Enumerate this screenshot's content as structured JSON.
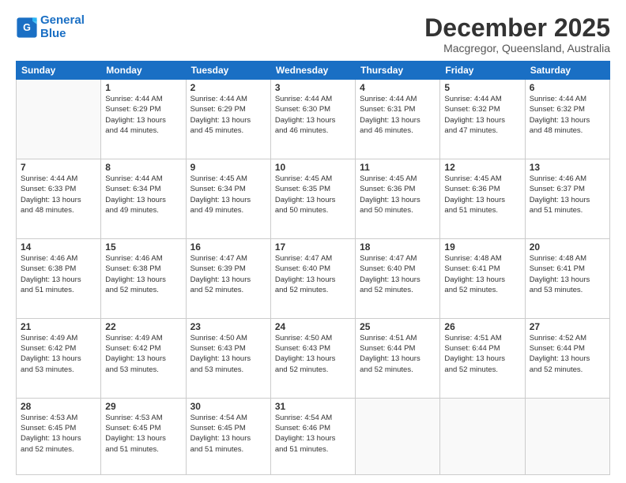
{
  "header": {
    "logo_line1": "General",
    "logo_line2": "Blue",
    "month": "December 2025",
    "location": "Macgregor, Queensland, Australia"
  },
  "weekdays": [
    "Sunday",
    "Monday",
    "Tuesday",
    "Wednesday",
    "Thursday",
    "Friday",
    "Saturday"
  ],
  "weeks": [
    [
      {
        "day": "",
        "info": ""
      },
      {
        "day": "1",
        "info": "Sunrise: 4:44 AM\nSunset: 6:29 PM\nDaylight: 13 hours\nand 44 minutes."
      },
      {
        "day": "2",
        "info": "Sunrise: 4:44 AM\nSunset: 6:29 PM\nDaylight: 13 hours\nand 45 minutes."
      },
      {
        "day": "3",
        "info": "Sunrise: 4:44 AM\nSunset: 6:30 PM\nDaylight: 13 hours\nand 46 minutes."
      },
      {
        "day": "4",
        "info": "Sunrise: 4:44 AM\nSunset: 6:31 PM\nDaylight: 13 hours\nand 46 minutes."
      },
      {
        "day": "5",
        "info": "Sunrise: 4:44 AM\nSunset: 6:32 PM\nDaylight: 13 hours\nand 47 minutes."
      },
      {
        "day": "6",
        "info": "Sunrise: 4:44 AM\nSunset: 6:32 PM\nDaylight: 13 hours\nand 48 minutes."
      }
    ],
    [
      {
        "day": "7",
        "info": "Sunrise: 4:44 AM\nSunset: 6:33 PM\nDaylight: 13 hours\nand 48 minutes."
      },
      {
        "day": "8",
        "info": "Sunrise: 4:44 AM\nSunset: 6:34 PM\nDaylight: 13 hours\nand 49 minutes."
      },
      {
        "day": "9",
        "info": "Sunrise: 4:45 AM\nSunset: 6:34 PM\nDaylight: 13 hours\nand 49 minutes."
      },
      {
        "day": "10",
        "info": "Sunrise: 4:45 AM\nSunset: 6:35 PM\nDaylight: 13 hours\nand 50 minutes."
      },
      {
        "day": "11",
        "info": "Sunrise: 4:45 AM\nSunset: 6:36 PM\nDaylight: 13 hours\nand 50 minutes."
      },
      {
        "day": "12",
        "info": "Sunrise: 4:45 AM\nSunset: 6:36 PM\nDaylight: 13 hours\nand 51 minutes."
      },
      {
        "day": "13",
        "info": "Sunrise: 4:46 AM\nSunset: 6:37 PM\nDaylight: 13 hours\nand 51 minutes."
      }
    ],
    [
      {
        "day": "14",
        "info": "Sunrise: 4:46 AM\nSunset: 6:38 PM\nDaylight: 13 hours\nand 51 minutes."
      },
      {
        "day": "15",
        "info": "Sunrise: 4:46 AM\nSunset: 6:38 PM\nDaylight: 13 hours\nand 52 minutes."
      },
      {
        "day": "16",
        "info": "Sunrise: 4:47 AM\nSunset: 6:39 PM\nDaylight: 13 hours\nand 52 minutes."
      },
      {
        "day": "17",
        "info": "Sunrise: 4:47 AM\nSunset: 6:40 PM\nDaylight: 13 hours\nand 52 minutes."
      },
      {
        "day": "18",
        "info": "Sunrise: 4:47 AM\nSunset: 6:40 PM\nDaylight: 13 hours\nand 52 minutes."
      },
      {
        "day": "19",
        "info": "Sunrise: 4:48 AM\nSunset: 6:41 PM\nDaylight: 13 hours\nand 52 minutes."
      },
      {
        "day": "20",
        "info": "Sunrise: 4:48 AM\nSunset: 6:41 PM\nDaylight: 13 hours\nand 53 minutes."
      }
    ],
    [
      {
        "day": "21",
        "info": "Sunrise: 4:49 AM\nSunset: 6:42 PM\nDaylight: 13 hours\nand 53 minutes."
      },
      {
        "day": "22",
        "info": "Sunrise: 4:49 AM\nSunset: 6:42 PM\nDaylight: 13 hours\nand 53 minutes."
      },
      {
        "day": "23",
        "info": "Sunrise: 4:50 AM\nSunset: 6:43 PM\nDaylight: 13 hours\nand 53 minutes."
      },
      {
        "day": "24",
        "info": "Sunrise: 4:50 AM\nSunset: 6:43 PM\nDaylight: 13 hours\nand 52 minutes."
      },
      {
        "day": "25",
        "info": "Sunrise: 4:51 AM\nSunset: 6:44 PM\nDaylight: 13 hours\nand 52 minutes."
      },
      {
        "day": "26",
        "info": "Sunrise: 4:51 AM\nSunset: 6:44 PM\nDaylight: 13 hours\nand 52 minutes."
      },
      {
        "day": "27",
        "info": "Sunrise: 4:52 AM\nSunset: 6:44 PM\nDaylight: 13 hours\nand 52 minutes."
      }
    ],
    [
      {
        "day": "28",
        "info": "Sunrise: 4:53 AM\nSunset: 6:45 PM\nDaylight: 13 hours\nand 52 minutes."
      },
      {
        "day": "29",
        "info": "Sunrise: 4:53 AM\nSunset: 6:45 PM\nDaylight: 13 hours\nand 51 minutes."
      },
      {
        "day": "30",
        "info": "Sunrise: 4:54 AM\nSunset: 6:45 PM\nDaylight: 13 hours\nand 51 minutes."
      },
      {
        "day": "31",
        "info": "Sunrise: 4:54 AM\nSunset: 6:46 PM\nDaylight: 13 hours\nand 51 minutes."
      },
      {
        "day": "",
        "info": ""
      },
      {
        "day": "",
        "info": ""
      },
      {
        "day": "",
        "info": ""
      }
    ]
  ]
}
